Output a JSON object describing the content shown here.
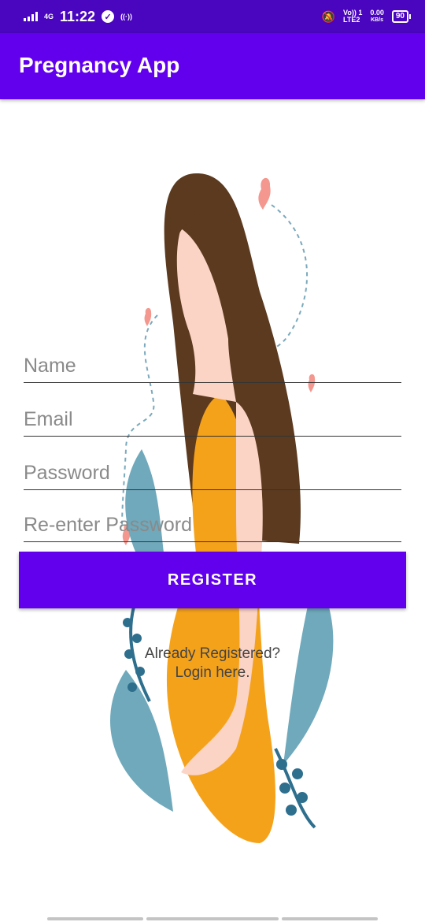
{
  "status_bar": {
    "network": "4G",
    "time": "11:22",
    "volte": "Vo)) 1",
    "lte": "LTE2",
    "speed_value": "0.00",
    "speed_unit": "KB/s",
    "battery": "90"
  },
  "app_bar": {
    "title": "Pregnancy App"
  },
  "form": {
    "name_placeholder": "Name",
    "email_placeholder": "Email",
    "password_placeholder": "Password",
    "reenter_placeholder": "Re-enter Password",
    "register_label": "REGISTER",
    "login_line1": "Already Registered?",
    "login_line2": "Login here."
  },
  "colors": {
    "status_bar": "#4a05bf",
    "primary": "#6200ee"
  }
}
